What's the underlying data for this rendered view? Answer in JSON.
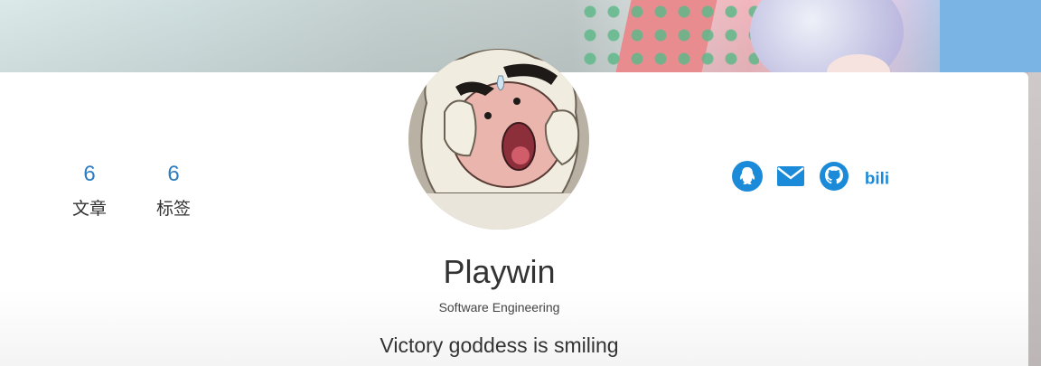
{
  "profile": {
    "name": "Playwin",
    "subtitle": "Software Engineering",
    "motto": "Victory goddess is smiling"
  },
  "stats": [
    {
      "value": "6",
      "label": "文章"
    },
    {
      "value": "6",
      "label": "标签"
    }
  ],
  "social": [
    {
      "icon": "qq-icon"
    },
    {
      "icon": "mail-icon"
    },
    {
      "icon": "github-icon"
    },
    {
      "icon": "bilibili-icon",
      "text": "bili"
    }
  ],
  "colors": {
    "accent": "#2b7cc0",
    "icon": "#1b8ad8"
  }
}
